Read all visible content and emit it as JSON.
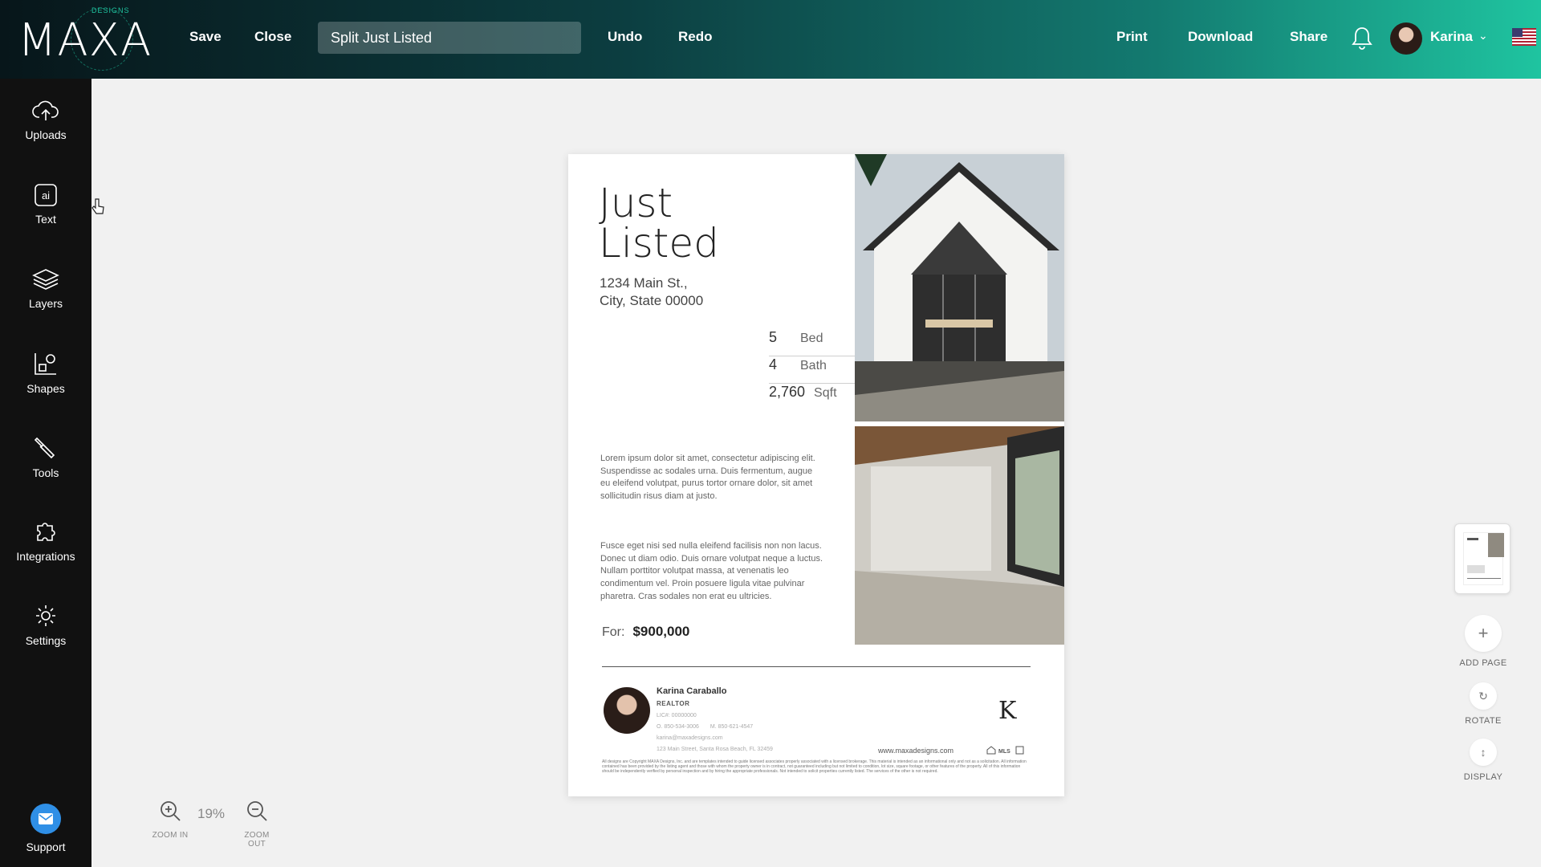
{
  "topbar": {
    "logo_text": "MAXA",
    "logo_ring_text": "DESIGNS",
    "save_label": "Save",
    "close_label": "Close",
    "document_name": "Split Just Listed",
    "undo_label": "Undo",
    "redo_label": "Redo",
    "print_label": "Print",
    "download_label": "Download",
    "share_label": "Share",
    "user_name": "Karina",
    "icons": {
      "notifications": "bell-icon",
      "user_menu": "chevron-down-icon",
      "language": "us-flag-icon"
    }
  },
  "sidebar": {
    "items": [
      {
        "label": "Uploads",
        "icon": "cloud-upload-icon"
      },
      {
        "label": "Text",
        "icon": "ai-text-icon"
      },
      {
        "label": "Layers",
        "icon": "layers-icon"
      },
      {
        "label": "Shapes",
        "icon": "shapes-icon"
      },
      {
        "label": "Tools",
        "icon": "tools-icon"
      },
      {
        "label": "Integrations",
        "icon": "puzzle-icon"
      },
      {
        "label": "Settings",
        "icon": "gear-icon"
      }
    ],
    "support_label": "Support",
    "support_icon": "mail-icon",
    "support_color": "#2f8fe6"
  },
  "flyer": {
    "title_line1": "Just",
    "title_line2": "Listed",
    "address_line1": "1234 Main St.,",
    "address_line2": "City, State 00000",
    "stats": [
      {
        "value": "5",
        "unit": "Bed"
      },
      {
        "value": "4",
        "unit": "Bath"
      },
      {
        "value": "2,760",
        "unit": "Sqft"
      }
    ],
    "paragraph1": "Lorem ipsum dolor sit amet, consectetur adipiscing elit. Suspendisse ac sodales urna. Duis fermentum, augue eu eleifend volutpat, purus tortor ornare dolor, sit amet sollicitudin risus diam at justo.",
    "paragraph2": "Fusce eget nisi sed nulla eleifend facilisis non non lacus. Donec ut diam odio. Duis ornare volutpat neque a luctus. Nullam porttitor volutpat massa, at venenatis leo condimentum vel. Proin posuere ligula vitae pulvinar pharetra. Cras sodales non erat eu ultricies.",
    "price_label": "For:",
    "price_value": "$900,000",
    "agent": {
      "name": "Karina Caraballo",
      "role": "REALTOR",
      "license": "LIC#: 00000000",
      "office_phone": "O. 850-534-3006",
      "mobile_phone": "M. 850-621-4547",
      "email": "karina@maxadesigns.com",
      "address": "123 Main Street, Santa Rosa Beach, FL 32459"
    },
    "brand_mark": "K",
    "website": "www.maxadesigns.com",
    "disclaimer": "All designs are Copyright MAXA Designs, Inc. and are templates intended to guide licensed associates properly associated with a licensed brokerage. This material is intended as an informational only and not as a solicitation. All information contained has been provided by the listing agent and those with whom the property owner is in contract, not guaranteed including but not limited to condition, lot size, square footage, or other features of the property. All of this information should be independently verified by personal inspection and by hiring the appropriate professionals. Not intended to solicit properties currently listed. The services of the other is not required."
  },
  "zoom": {
    "zoom_in_label": "ZOOM IN",
    "zoom_out_label": "ZOOM OUT",
    "level": "19%"
  },
  "right_panel": {
    "add_page_label": "ADD PAGE",
    "rotate_label": "ROTATE",
    "display_label": "DISPLAY"
  }
}
